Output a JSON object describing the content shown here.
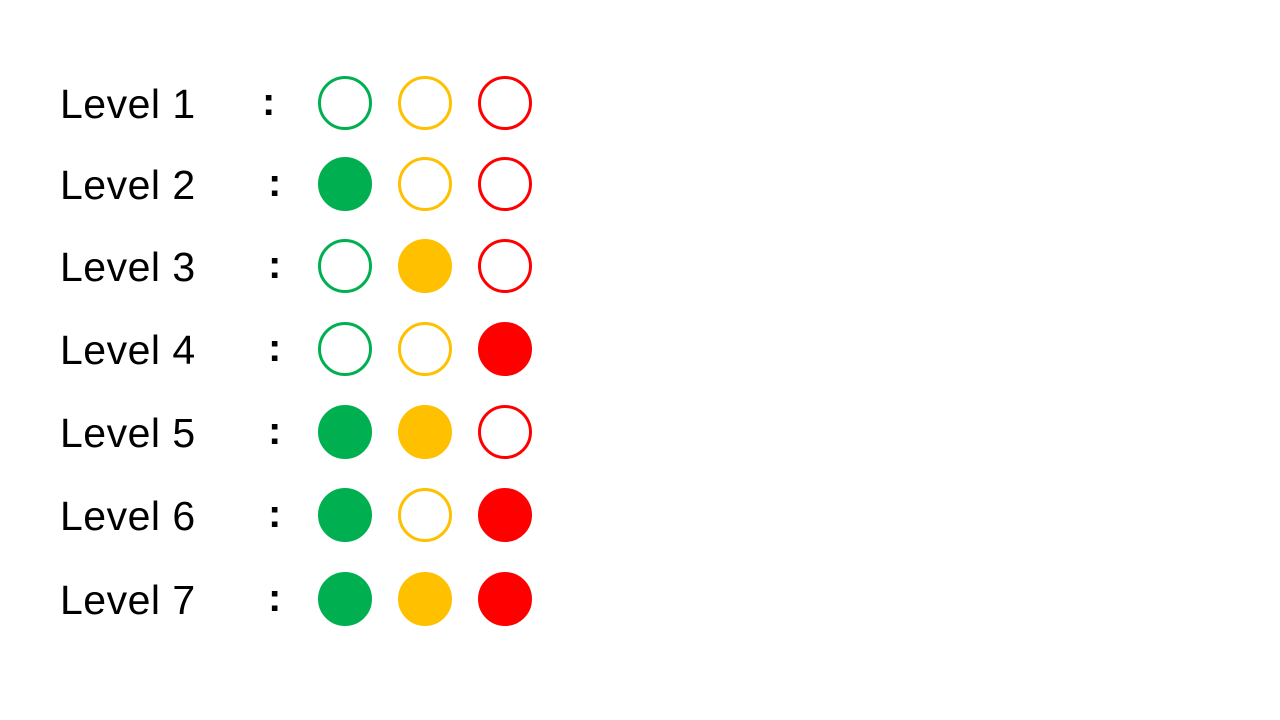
{
  "colors": {
    "green": "#00B050",
    "yellow": "#FFC000",
    "red": "#FF0000"
  },
  "separator": ":",
  "levels": [
    {
      "label": "Level 1",
      "green": false,
      "yellow": false,
      "red": false
    },
    {
      "label": "Level 2",
      "green": true,
      "yellow": false,
      "red": false
    },
    {
      "label": "Level 3",
      "green": false,
      "yellow": true,
      "red": false
    },
    {
      "label": "Level 4",
      "green": false,
      "yellow": false,
      "red": true
    },
    {
      "label": "Level 5",
      "green": true,
      "yellow": true,
      "red": false
    },
    {
      "label": "Level 6",
      "green": true,
      "yellow": false,
      "red": true
    },
    {
      "label": "Level 7",
      "green": true,
      "yellow": true,
      "red": true
    }
  ]
}
